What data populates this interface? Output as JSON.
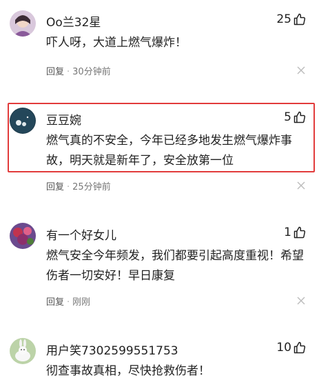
{
  "comments": [
    {
      "username": "Oo兰32星",
      "likes": "25",
      "content": "吓人呀，大道上燃气爆炸！",
      "reply_label": "回复",
      "separator": "·",
      "time": "30分钟前"
    },
    {
      "username": "豆豆婉",
      "likes": "5",
      "content": "燃气真的不安全，今年已经多地发生燃气爆炸事故，明天就是新年了，安全放第一位",
      "reply_label": "回复",
      "separator": "·",
      "time": "25分钟前"
    },
    {
      "username": "有一个好女儿",
      "likes": "1",
      "content": "燃气安全今年频发，我们都要引起高度重视！希望伤者一切安好！早日康复",
      "reply_label": "回复",
      "separator": "·",
      "time": "刚刚"
    },
    {
      "username": "用户笑7302599551753",
      "likes": "10",
      "content": "彻查事故真相，尽快抢救伤者！"
    }
  ],
  "colors": {
    "highlight_border": "#e23b3b",
    "meta_text": "#777777"
  },
  "icons": {
    "like": "thumbs-up-icon",
    "close": "close-icon"
  }
}
